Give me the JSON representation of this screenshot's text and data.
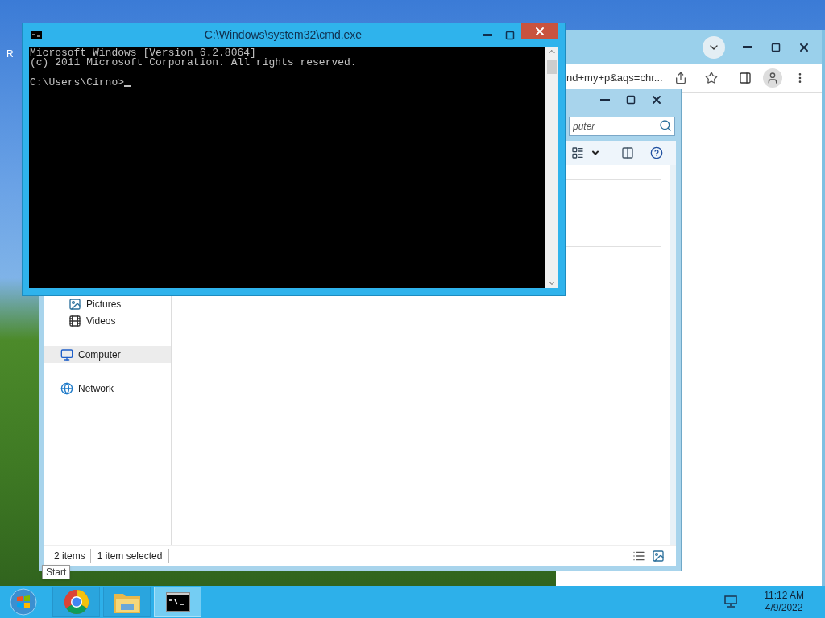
{
  "desktop": {
    "icon_label": "R"
  },
  "chrome_window": {
    "address": "nd+my+p&aqs=chr..."
  },
  "explorer_window": {
    "search": {
      "placeholder": "puter"
    },
    "library_items": [
      {
        "label": "Pictures",
        "kind": "pictures",
        "selected": false
      },
      {
        "label": "Videos",
        "kind": "videos",
        "selected": false
      }
    ],
    "nav_items": [
      {
        "label": "Computer",
        "kind": "computer",
        "selected": true
      },
      {
        "label": "Network",
        "kind": "network",
        "selected": false
      }
    ],
    "status_bar": {
      "item_count": "2 items",
      "selection": "1 item selected"
    }
  },
  "cmd_window": {
    "title": "C:\\Windows\\system32\\cmd.exe",
    "output": [
      "Microsoft Windows [Version 6.2.8064]",
      "(c) 2011 Microsoft Corporation. All rights reserved."
    ],
    "prompt": "C:\\Users\\Cirno>"
  },
  "tooltip": {
    "text": "Start"
  },
  "taskbar": {
    "apps": [
      {
        "kind": "chrome",
        "selected": false
      },
      {
        "kind": "explorer",
        "selected": false
      },
      {
        "kind": "cmd",
        "selected": true
      }
    ],
    "clock": {
      "time": "11:12 AM",
      "date": "4/9/2022"
    }
  }
}
